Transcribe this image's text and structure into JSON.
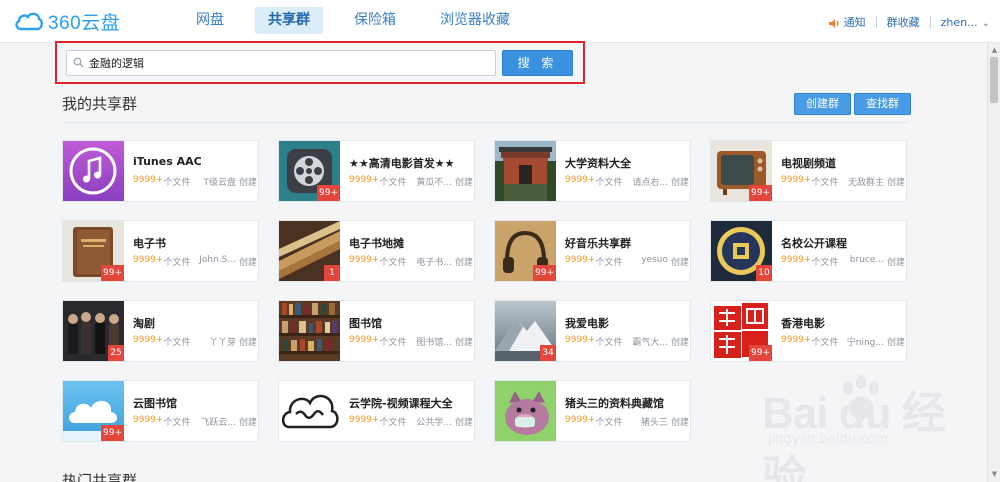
{
  "app": {
    "logo_text": "360云盘"
  },
  "nav": {
    "items": [
      {
        "label": "网盘"
      },
      {
        "label": "共享群"
      },
      {
        "label": "保险箱"
      },
      {
        "label": "浏览器收藏"
      }
    ],
    "active_index": 1,
    "notify_label": "通知",
    "fav_label": "群收藏",
    "user_label": "zhen..."
  },
  "search": {
    "value": "金融的逻辑",
    "button_label": "搜 索"
  },
  "section": {
    "title": "我的共享群",
    "create_label": "创建群",
    "find_label": "查找群"
  },
  "groups": [
    {
      "name": "iTunes AAC",
      "count": "9999+",
      "files_label": "个文件",
      "owner": "T级云盘",
      "action": "创建",
      "badge": ""
    },
    {
      "name": "★★高清电影首发★★",
      "count": "9999+",
      "files_label": "个文件",
      "owner": "黄瓜不...",
      "action": "创建",
      "badge": "99+"
    },
    {
      "name": "大学资料大全",
      "count": "9999+",
      "files_label": "个文件",
      "owner": "请点右...",
      "action": "创建",
      "badge": ""
    },
    {
      "name": "电视剧频道",
      "count": "9999+",
      "files_label": "个文件",
      "owner": "无敌群主",
      "action": "创建",
      "badge": "99+"
    },
    {
      "name": "电子书",
      "count": "9999+",
      "files_label": "个文件",
      "owner": "John.S...",
      "action": "创建",
      "badge": "99+"
    },
    {
      "name": "电子书地摊",
      "count": "9999+",
      "files_label": "个文件",
      "owner": "电子书...",
      "action": "创建",
      "badge": "1"
    },
    {
      "name": "好音乐共享群",
      "count": "9999+",
      "files_label": "个文件",
      "owner": "yesuo",
      "action": "创建",
      "badge": "99+"
    },
    {
      "name": "名校公开课程",
      "count": "9999+",
      "files_label": "个文件",
      "owner": "bruce...",
      "action": "创建",
      "badge": "10"
    },
    {
      "name": "淘剧",
      "count": "9999+",
      "files_label": "个文件",
      "owner": "丫丫芽",
      "action": "创建",
      "badge": "25"
    },
    {
      "name": "图书馆",
      "count": "9999+",
      "files_label": "个文件",
      "owner": "图书馆...",
      "action": "创建",
      "badge": ""
    },
    {
      "name": "我爱电影",
      "count": "9999+",
      "files_label": "个文件",
      "owner": "霸气大...",
      "action": "创建",
      "badge": "34"
    },
    {
      "name": "香港电影",
      "count": "9999+",
      "files_label": "个文件",
      "owner": "宁ning...",
      "action": "创建",
      "badge": "99+"
    },
    {
      "name": "云图书馆",
      "count": "9999+",
      "files_label": "个文件",
      "owner": "飞跃云...",
      "action": "创建",
      "badge": "99+"
    },
    {
      "name": "云学院-视频课程大全",
      "count": "9999+",
      "files_label": "个文件",
      "owner": "公共学...",
      "action": "创建",
      "badge": ""
    },
    {
      "name": "猪头三的资料典藏馆",
      "count": "9999+",
      "files_label": "个文件",
      "owner": "猪头三",
      "action": "创建",
      "badge": ""
    }
  ],
  "hot_section": {
    "title": "热门共享群"
  },
  "watermark": {
    "text": "Bai du 经验",
    "url": "jingyan.baidu.com"
  },
  "colors": {
    "brand": "#2f9ff0",
    "button": "#3a91e0",
    "badge": "#e4463c",
    "count": "#f59a23",
    "highlight_border": "#e0232a"
  }
}
